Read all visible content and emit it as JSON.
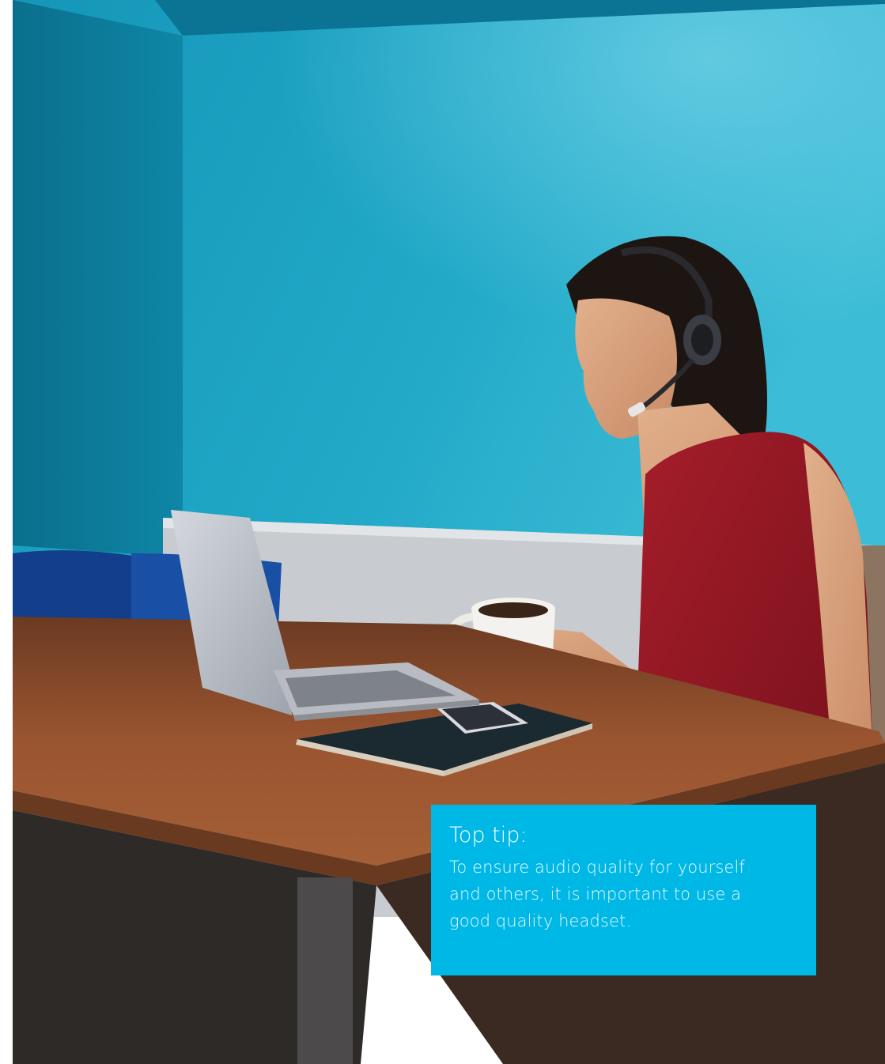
{
  "tip": {
    "title": "Top tip:",
    "body_lines": [
      "To ensure audio quality for yourself",
      "and others, it is important to use a",
      "good quality headset."
    ]
  },
  "colors": {
    "card": "#00b8e6",
    "wall": "#1e9fbf",
    "shirt": "#8d1622",
    "table": "#8a4a2a"
  },
  "photo": {
    "subject": "photo-woman-with-headset-at-laptop"
  }
}
